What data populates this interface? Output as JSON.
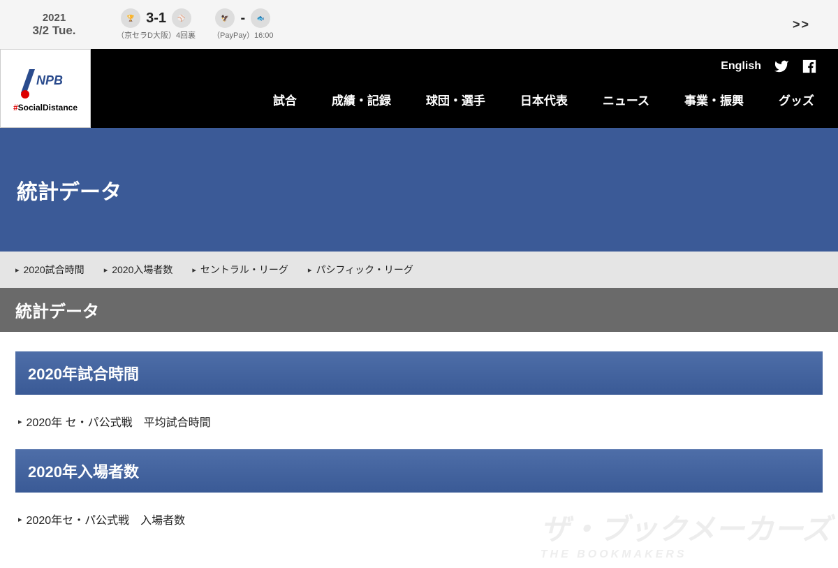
{
  "scorebar": {
    "date_year": "2021",
    "date_day": "3/2 Tue.",
    "games": [
      {
        "score": "3-1",
        "venue": "（京セラD大阪）4回裏"
      },
      {
        "score": "-",
        "venue": "（PayPay）16:00"
      }
    ],
    "next": ">>"
  },
  "header": {
    "logo_text": "NPB",
    "social_tag": "#SocialDistance",
    "lang": "English",
    "nav": [
      "試合",
      "成績・記録",
      "球団・選手",
      "日本代表",
      "ニュース",
      "事業・振興",
      "グッズ"
    ]
  },
  "hero": {
    "title": "統計データ"
  },
  "sublinks": [
    "2020試合時間",
    "2020入場者数",
    "セントラル・リーグ",
    "パシフィック・リーグ"
  ],
  "graybar": {
    "title": "統計データ"
  },
  "sections": [
    {
      "title": "2020年試合時間",
      "links": [
        "2020年 セ・パ公式戦　平均試合時間"
      ]
    },
    {
      "title": "2020年入場者数",
      "links": [
        "2020年セ・パ公式戦　入場者数"
      ]
    }
  ],
  "watermark": {
    "main": "ザ・ブックメーカーズ",
    "sub": "THE BOOKMAKERS"
  }
}
